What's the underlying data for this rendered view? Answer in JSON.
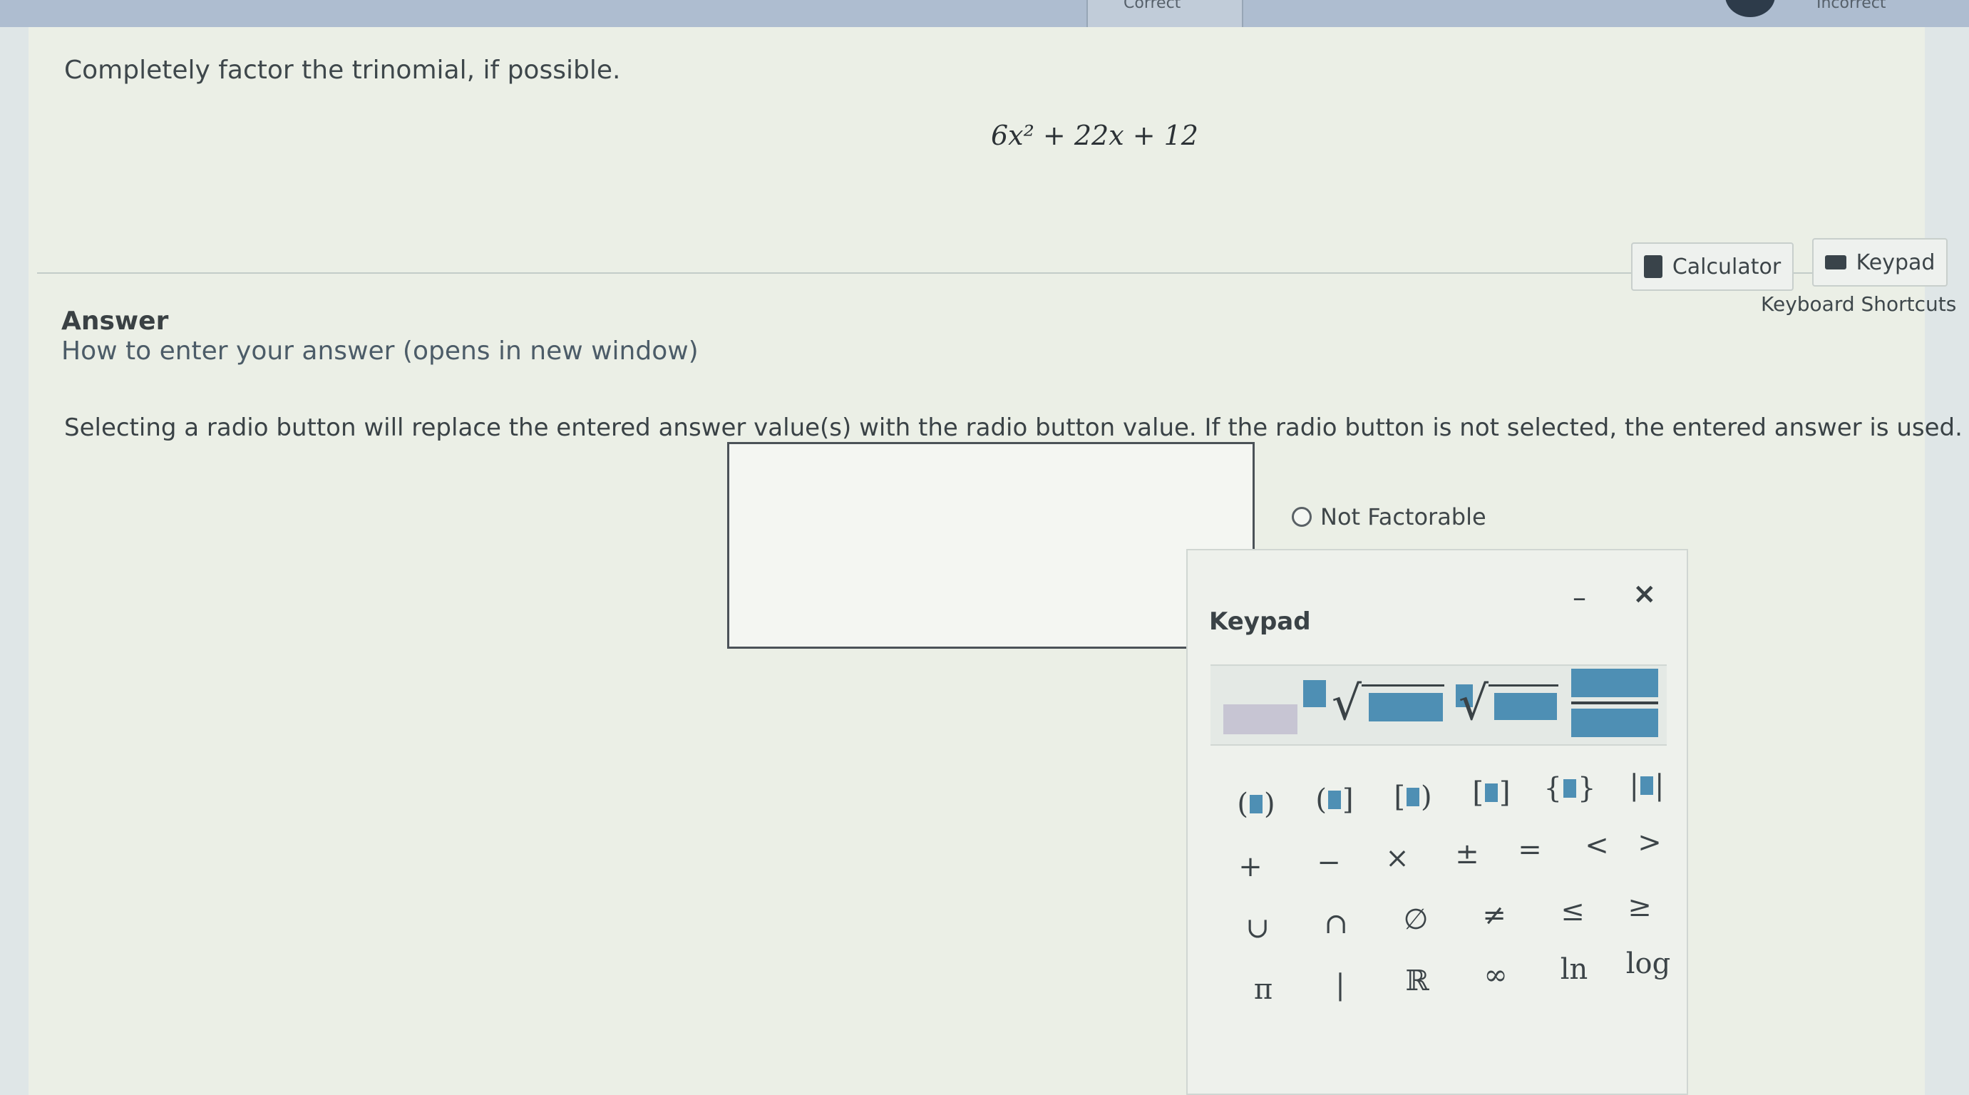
{
  "header": {
    "tab_partial_label": "Correct",
    "status_partial_label": "Incorrect"
  },
  "question": {
    "prompt": "Completely factor the trinomial, if possible.",
    "expression": "6x² + 22x + 12"
  },
  "answer_section": {
    "heading": "Answer",
    "help_link": "How to enter your answer (opens in new window)",
    "calculator_label": "Calculator",
    "keypad_label": "Keypad",
    "shortcuts_link": "Keyboard Shortcuts",
    "instructions": "Selecting a radio button will replace the entered answer value(s) with the radio button value. If the radio button is not selected, the entered answer is used.",
    "answer_input_value": "",
    "radio_option": "Not Factorable"
  },
  "keypad": {
    "title": "Keypad",
    "minimize_label": "–",
    "close_label": "×",
    "templates": [
      "superscript",
      "square-root",
      "nth-root",
      "fraction"
    ],
    "bracket_keys": [
      "parentheses",
      "half-open-left",
      "half-open-right",
      "square-brackets",
      "braces",
      "absolute-value"
    ],
    "operator_keys": [
      "+",
      "−",
      "×",
      "±",
      "=",
      "<",
      ">"
    ],
    "set_keys": [
      "∪",
      "∩",
      "∅",
      "≠",
      "≤",
      "≥"
    ],
    "constant_keys": [
      "π",
      "|",
      "ℝ",
      "∞",
      "ln",
      "log"
    ]
  },
  "colors": {
    "accent_slot": "#4e8fb4",
    "slot_gray": "#c7c5d3",
    "page_background": "#ebefe6"
  }
}
